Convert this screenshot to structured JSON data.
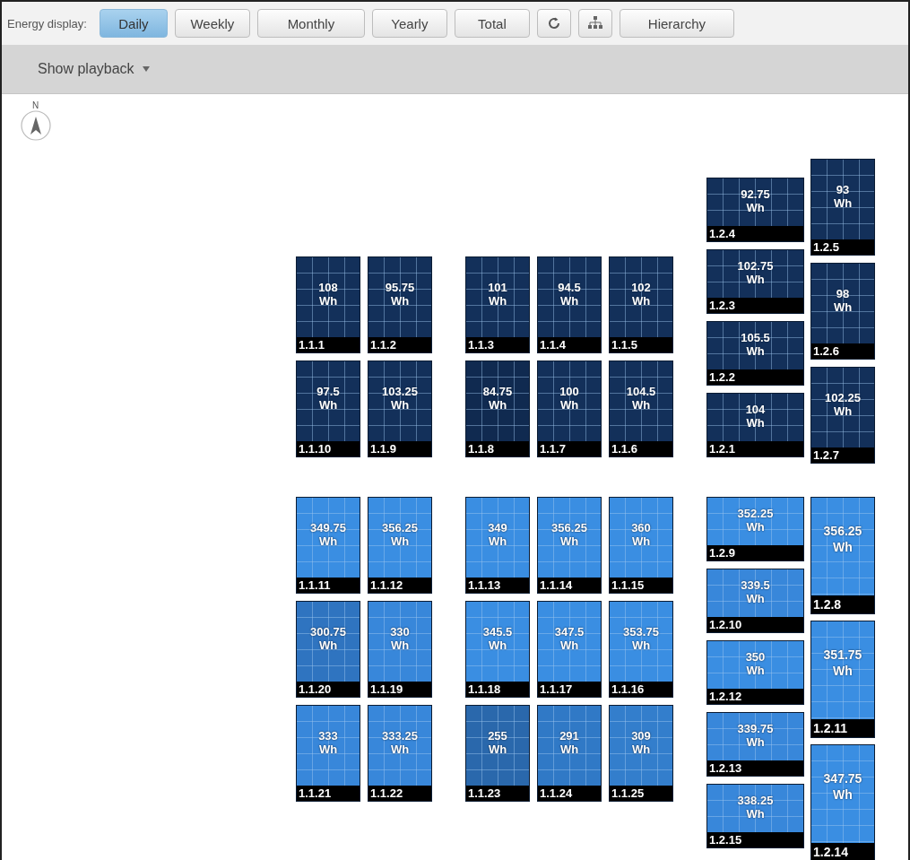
{
  "toolbar": {
    "label": "Energy display:",
    "tabs": [
      {
        "label": "Daily",
        "selected": true
      },
      {
        "label": "Weekly",
        "selected": false
      },
      {
        "label": "Monthly",
        "selected": false
      },
      {
        "label": "Yearly",
        "selected": false
      },
      {
        "label": "Total",
        "selected": false
      }
    ],
    "hierarchy_button": "Hierarchy"
  },
  "playback": {
    "label": "Show playback"
  },
  "compass": {
    "label": "N"
  },
  "groups": [
    {
      "kind": "portrait",
      "panels": [
        {
          "energy": "108",
          "unit": "Wh",
          "id": "1.1.1",
          "color": "#13305a"
        },
        {
          "energy": "95.75",
          "unit": "Wh",
          "id": "1.1.2",
          "color": "#13305a"
        },
        {
          "energy": "97.5",
          "unit": "Wh",
          "id": "1.1.10",
          "color": "#13305a"
        },
        {
          "energy": "103.25",
          "unit": "Wh",
          "id": "1.1.9",
          "color": "#13305a"
        }
      ]
    },
    {
      "kind": "portrait",
      "panels": [
        {
          "energy": "101",
          "unit": "Wh",
          "id": "1.1.3",
          "color": "#13305a"
        },
        {
          "energy": "94.5",
          "unit": "Wh",
          "id": "1.1.4",
          "color": "#13305a"
        },
        {
          "energy": "102",
          "unit": "Wh",
          "id": "1.1.5",
          "color": "#13305a"
        },
        {
          "energy": "84.75",
          "unit": "Wh",
          "id": "1.1.8",
          "color": "#102a50"
        },
        {
          "energy": "100",
          "unit": "Wh",
          "id": "1.1.7",
          "color": "#13305a"
        },
        {
          "energy": "104.5",
          "unit": "Wh",
          "id": "1.1.6",
          "color": "#13305a"
        }
      ]
    },
    {
      "kind": "landscape",
      "panels": [
        {
          "energy": "92.75",
          "unit": "Wh",
          "id": "1.2.4",
          "color": "#13305a"
        },
        {
          "energy": "102.75",
          "unit": "Wh",
          "id": "1.2.3",
          "color": "#13305a"
        },
        {
          "energy": "105.5",
          "unit": "Wh",
          "id": "1.2.2",
          "color": "#13305a"
        },
        {
          "energy": "104",
          "unit": "Wh",
          "id": "1.2.1",
          "color": "#13305a"
        }
      ]
    },
    {
      "kind": "portrait",
      "panels": [
        {
          "energy": "93",
          "unit": "Wh",
          "id": "1.2.5",
          "color": "#13305a"
        },
        {
          "energy": "98",
          "unit": "Wh",
          "id": "1.2.6",
          "color": "#13305a"
        },
        {
          "energy": "102.25",
          "unit": "Wh",
          "id": "1.2.7",
          "color": "#13305a"
        }
      ]
    },
    {
      "kind": "portrait",
      "panels": [
        {
          "energy": "349.75",
          "unit": "Wh",
          "id": "1.1.11",
          "color": "#3a8ee2"
        },
        {
          "energy": "356.25",
          "unit": "Wh",
          "id": "1.1.12",
          "color": "#3a8ee2"
        },
        {
          "energy": "300.75",
          "unit": "Wh",
          "id": "1.1.20",
          "color": "#2f74c0"
        },
        {
          "energy": "330",
          "unit": "Wh",
          "id": "1.1.19",
          "color": "#3887da"
        },
        {
          "energy": "333",
          "unit": "Wh",
          "id": "1.1.21",
          "color": "#3887da"
        },
        {
          "energy": "333.25",
          "unit": "Wh",
          "id": "1.1.22",
          "color": "#3887da"
        }
      ]
    },
    {
      "kind": "portrait",
      "panels": [
        {
          "energy": "349",
          "unit": "Wh",
          "id": "1.1.13",
          "color": "#3a8ee2"
        },
        {
          "energy": "356.25",
          "unit": "Wh",
          "id": "1.1.14",
          "color": "#3a8ee2"
        },
        {
          "energy": "360",
          "unit": "Wh",
          "id": "1.1.15",
          "color": "#3a8ee2"
        },
        {
          "energy": "345.5",
          "unit": "Wh",
          "id": "1.1.18",
          "color": "#3a8ee2"
        },
        {
          "energy": "347.5",
          "unit": "Wh",
          "id": "1.1.17",
          "color": "#3a8ee2"
        },
        {
          "energy": "353.75",
          "unit": "Wh",
          "id": "1.1.16",
          "color": "#3a8ee2"
        },
        {
          "energy": "255",
          "unit": "Wh",
          "id": "1.1.23",
          "color": "#2a68ac"
        },
        {
          "energy": "291",
          "unit": "Wh",
          "id": "1.1.24",
          "color": "#3079c6"
        },
        {
          "energy": "309",
          "unit": "Wh",
          "id": "1.1.25",
          "color": "#337ecc"
        }
      ]
    },
    {
      "kind": "landscape",
      "panels": [
        {
          "energy": "352.25",
          "unit": "Wh",
          "id": "1.2.9",
          "color": "#3a8ee2"
        },
        {
          "energy": "339.5",
          "unit": "Wh",
          "id": "1.2.10",
          "color": "#3887da"
        },
        {
          "energy": "350",
          "unit": "Wh",
          "id": "1.2.12",
          "color": "#3a8ee2"
        },
        {
          "energy": "339.75",
          "unit": "Wh",
          "id": "1.2.13",
          "color": "#3887da"
        },
        {
          "energy": "338.25",
          "unit": "Wh",
          "id": "1.2.15",
          "color": "#3887da"
        }
      ]
    },
    {
      "kind": "tall",
      "panels": [
        {
          "energy": "356.25",
          "unit": "Wh",
          "id": "1.2.8",
          "color": "#3a8ee2"
        },
        {
          "energy": "351.75",
          "unit": "Wh",
          "id": "1.2.11",
          "color": "#3a8ee2"
        },
        {
          "energy": "347.75",
          "unit": "Wh",
          "id": "1.2.14",
          "color": "#3a8ee2"
        }
      ]
    }
  ]
}
